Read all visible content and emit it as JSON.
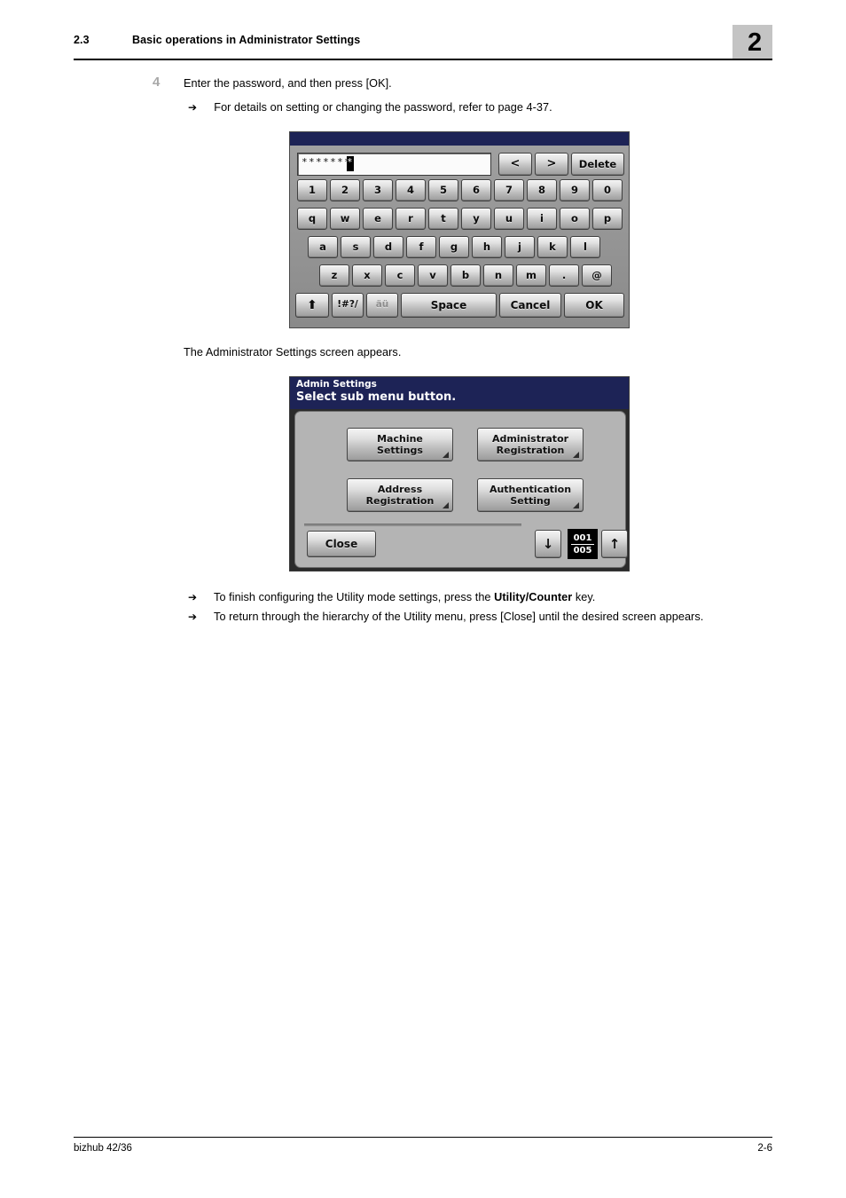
{
  "header": {
    "section_number": "2.3",
    "title": "Basic operations in Administrator Settings",
    "chapter": "2"
  },
  "footer": {
    "product": "bizhub 42/36",
    "page": "2-6"
  },
  "body": {
    "step_number": "4",
    "step_text": "Enter the password, and then press [OK].",
    "step_note": "For details on setting or changing the password, refer to page 4-37.",
    "caption": "The Administrator Settings screen appears.",
    "note_1_pre": "To finish configuring the Utility mode settings, press the ",
    "note_1_bold": "Utility/Counter",
    "note_1_post": " key.",
    "note_2": "To return through the hierarchy of the Utility menu, press [Close] until the desired screen appears.",
    "arrow_glyph": "➔"
  },
  "keyboard_screen": {
    "password_value": "*******",
    "cursor_char": "*",
    "edit_buttons": [
      {
        "label": "<",
        "name": "cursor-left-button"
      },
      {
        "label": ">",
        "name": "cursor-right-button"
      },
      {
        "label": "Delete",
        "name": "delete-button"
      }
    ],
    "row_numbers": [
      "1",
      "2",
      "3",
      "4",
      "5",
      "6",
      "7",
      "8",
      "9",
      "0"
    ],
    "row_q": [
      "q",
      "w",
      "e",
      "r",
      "t",
      "y",
      "u",
      "i",
      "o",
      "p"
    ],
    "row_a": [
      "a",
      "s",
      "d",
      "f",
      "g",
      "h",
      "j",
      "k",
      "l"
    ],
    "row_z": [
      "z",
      "x",
      "c",
      "v",
      "b",
      "n",
      "m",
      ".",
      "@"
    ],
    "shift_label": "⬆",
    "symbols_label": "!#?/",
    "accents_label": "äü",
    "space_label": "Space",
    "cancel_label": "Cancel",
    "ok_label": "OK",
    "colors": {
      "titlebar": "#1d2356",
      "panel": "#8f8f8f"
    }
  },
  "admin_screen": {
    "title_small": "Admin Settings",
    "title_large": "Select sub menu button.",
    "buttons": [
      {
        "line1": "Machine",
        "line2": "Settings"
      },
      {
        "line1": "Administrator",
        "line2": "Registration"
      },
      {
        "line1": "Address",
        "line2": "Registration"
      },
      {
        "line1": "Authentication",
        "line2": "Setting"
      }
    ],
    "close_label": "Close",
    "page_down_label": "↓",
    "page_up_label": "↑",
    "counter_current": "001",
    "counter_total": "005",
    "colors": {
      "titlebar": "#1d2356",
      "body": "#b4b4b4"
    }
  }
}
